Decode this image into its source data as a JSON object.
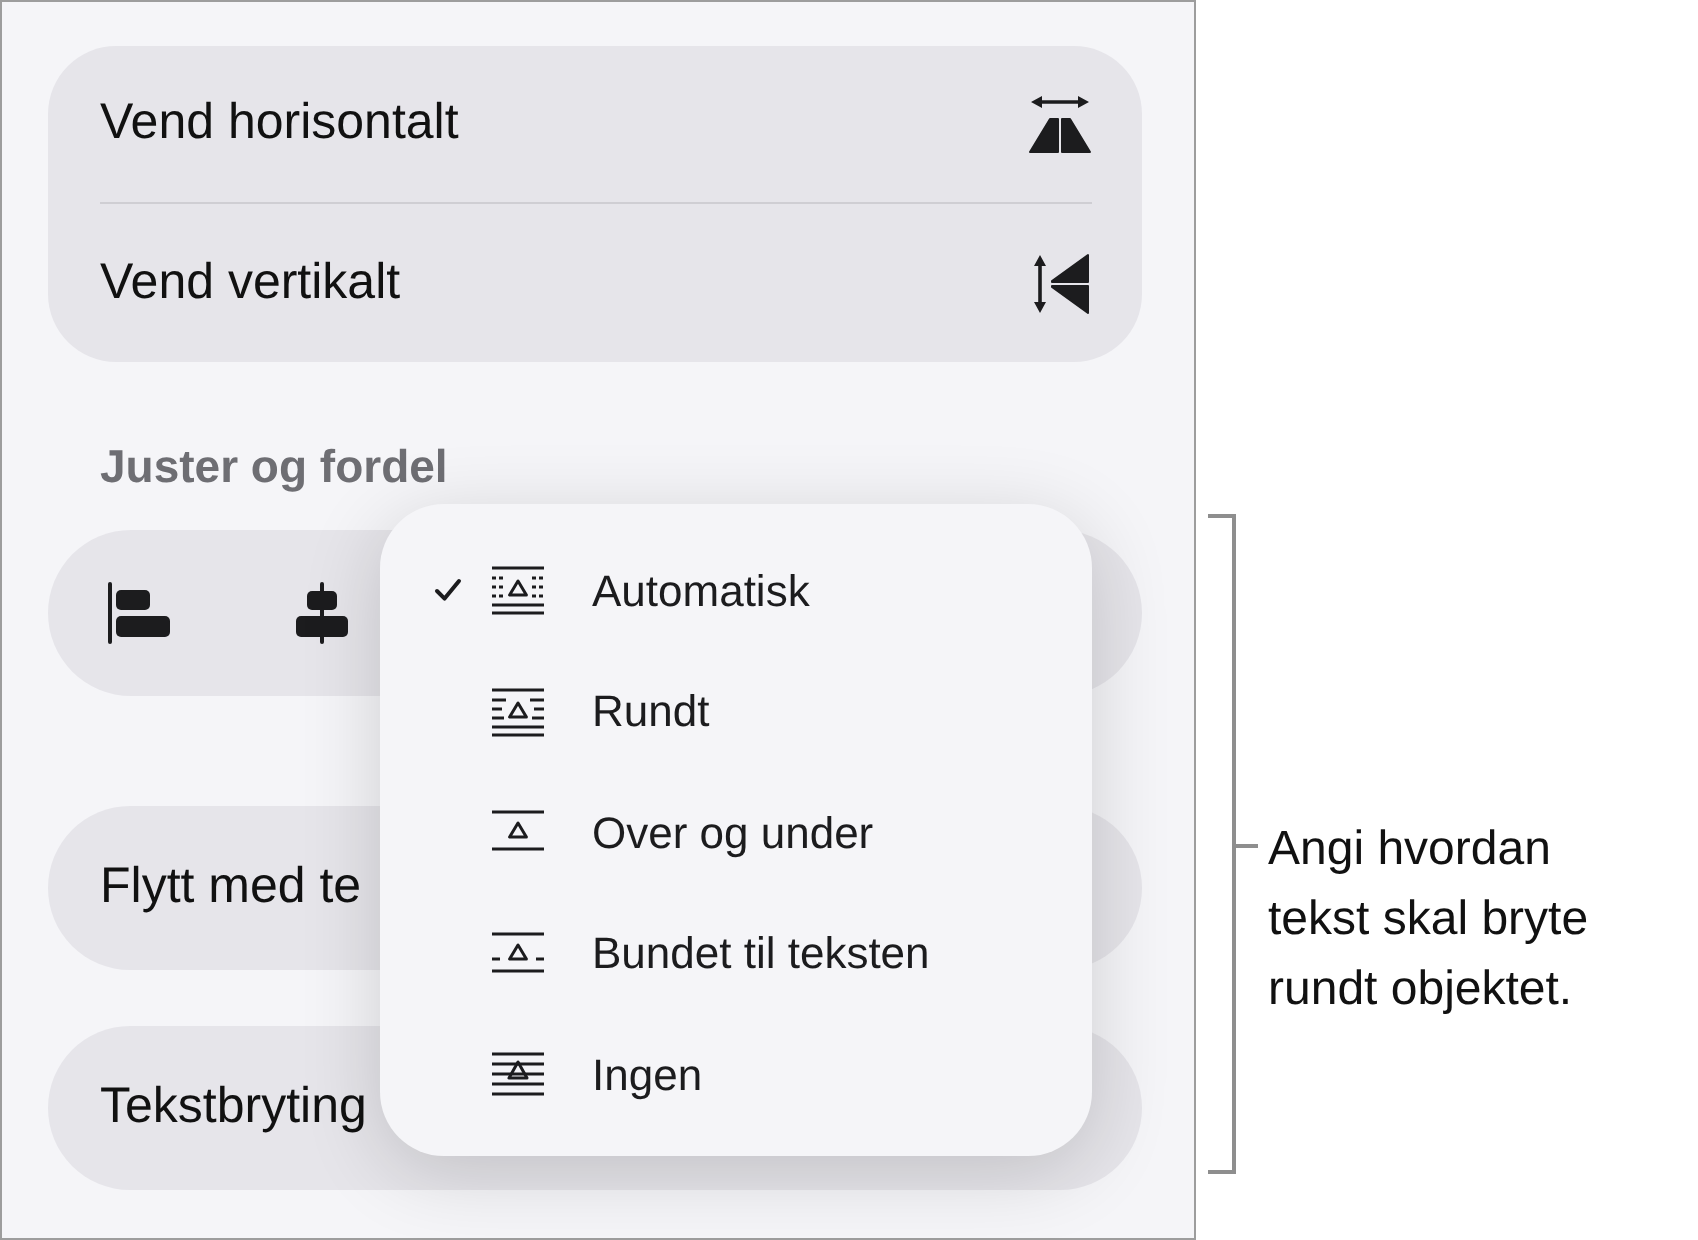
{
  "flip_group": {
    "items": [
      {
        "kind": "flip_horizontal",
        "label": "Vend horisontalt"
      },
      {
        "kind": "flip_vertical",
        "label": "Vend vertikalt"
      }
    ]
  },
  "align_section": {
    "title": "Juster og fordel",
    "buttons": [
      {
        "kind": "align_left"
      },
      {
        "kind": "align_center"
      }
    ]
  },
  "option_rows": [
    {
      "label": "Flytt med te"
    },
    {
      "label": "Tekstbryting"
    }
  ],
  "wrap_menu": {
    "items": [
      {
        "kind": "automatic",
        "label": "Automatisk",
        "selected": true
      },
      {
        "kind": "around",
        "label": "Rundt",
        "selected": false
      },
      {
        "kind": "above_below",
        "label": "Over og under",
        "selected": false
      },
      {
        "kind": "inline",
        "label": "Bundet til teksten",
        "selected": false
      },
      {
        "kind": "none",
        "label": "Ingen",
        "selected": false
      }
    ]
  },
  "callout": {
    "text": "Angi hvordan tekst skal bryte rundt objektet."
  }
}
